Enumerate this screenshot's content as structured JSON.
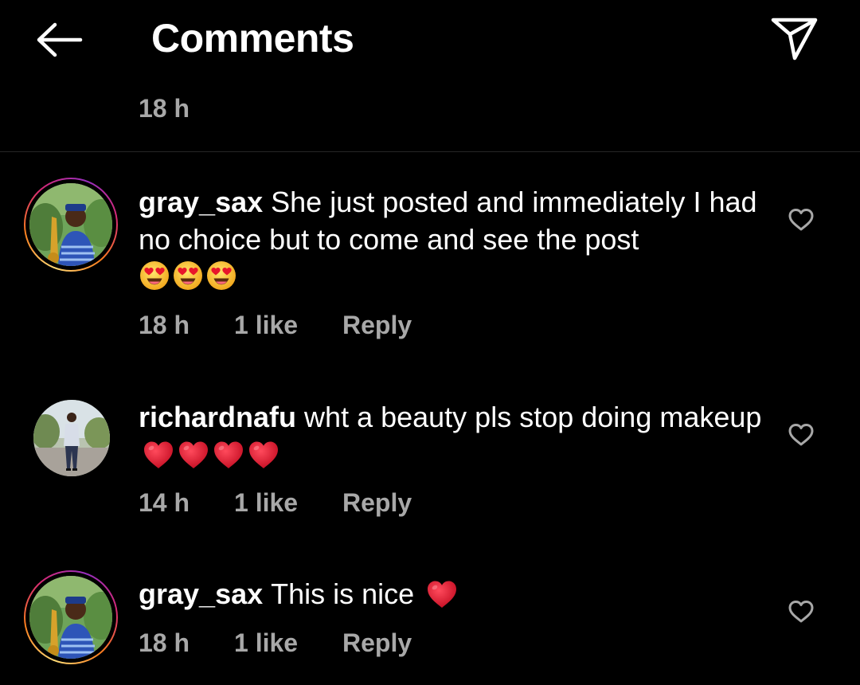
{
  "header": {
    "title": "Comments",
    "back_icon": "arrow-left-icon",
    "share_icon": "paper-plane-icon"
  },
  "caption": {
    "time": "18 h"
  },
  "comments": [
    {
      "username": "gray_sax",
      "text": "She just posted and immediately I had no choice but to come and see the post",
      "emoji": [
        "heart-eyes",
        "heart-eyes",
        "heart-eyes"
      ],
      "time": "18 h",
      "likes": "1 like",
      "reply": "Reply",
      "has_story": true
    },
    {
      "username": "richardnafu",
      "text": "wht a beauty pls stop doing makeup",
      "emoji": [
        "red-heart",
        "red-heart",
        "red-heart",
        "red-heart"
      ],
      "time": "14 h",
      "likes": "1 like",
      "reply": "Reply",
      "has_story": false
    },
    {
      "username": "gray_sax",
      "text": "This is nice",
      "emoji": [
        "red-heart"
      ],
      "time": "18 h",
      "likes": "1 like",
      "reply": "Reply",
      "has_story": true
    }
  ],
  "colors": {
    "background": "#000000",
    "text": "#ffffff",
    "muted": "#a8a8a8",
    "divider": "#262626",
    "heart_emoji": "#e0162b",
    "face_emoji": "#f9c623"
  }
}
